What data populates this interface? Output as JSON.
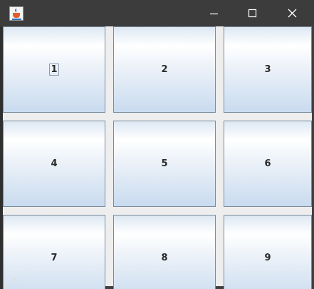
{
  "window": {
    "title": "",
    "icon": "java-coffee-cup-icon",
    "controls": {
      "minimize_icon": "minimize-icon",
      "maximize_icon": "maximize-icon",
      "close_icon": "close-icon"
    }
  },
  "grid": {
    "buttons": [
      {
        "label": "1",
        "focused": true
      },
      {
        "label": "2",
        "focused": false
      },
      {
        "label": "3",
        "focused": false
      },
      {
        "label": "4",
        "focused": false
      },
      {
        "label": "5",
        "focused": false
      },
      {
        "label": "6",
        "focused": false
      },
      {
        "label": "7",
        "focused": false
      },
      {
        "label": "8",
        "focused": false
      },
      {
        "label": "9",
        "focused": false
      }
    ]
  },
  "colors": {
    "titlebar": "#3c3c3c",
    "panel_background": "#eeeeee",
    "button_gradient_top": "#ffffff",
    "button_gradient_bottom": "#c9dbef",
    "button_border": "#7a8a99"
  }
}
